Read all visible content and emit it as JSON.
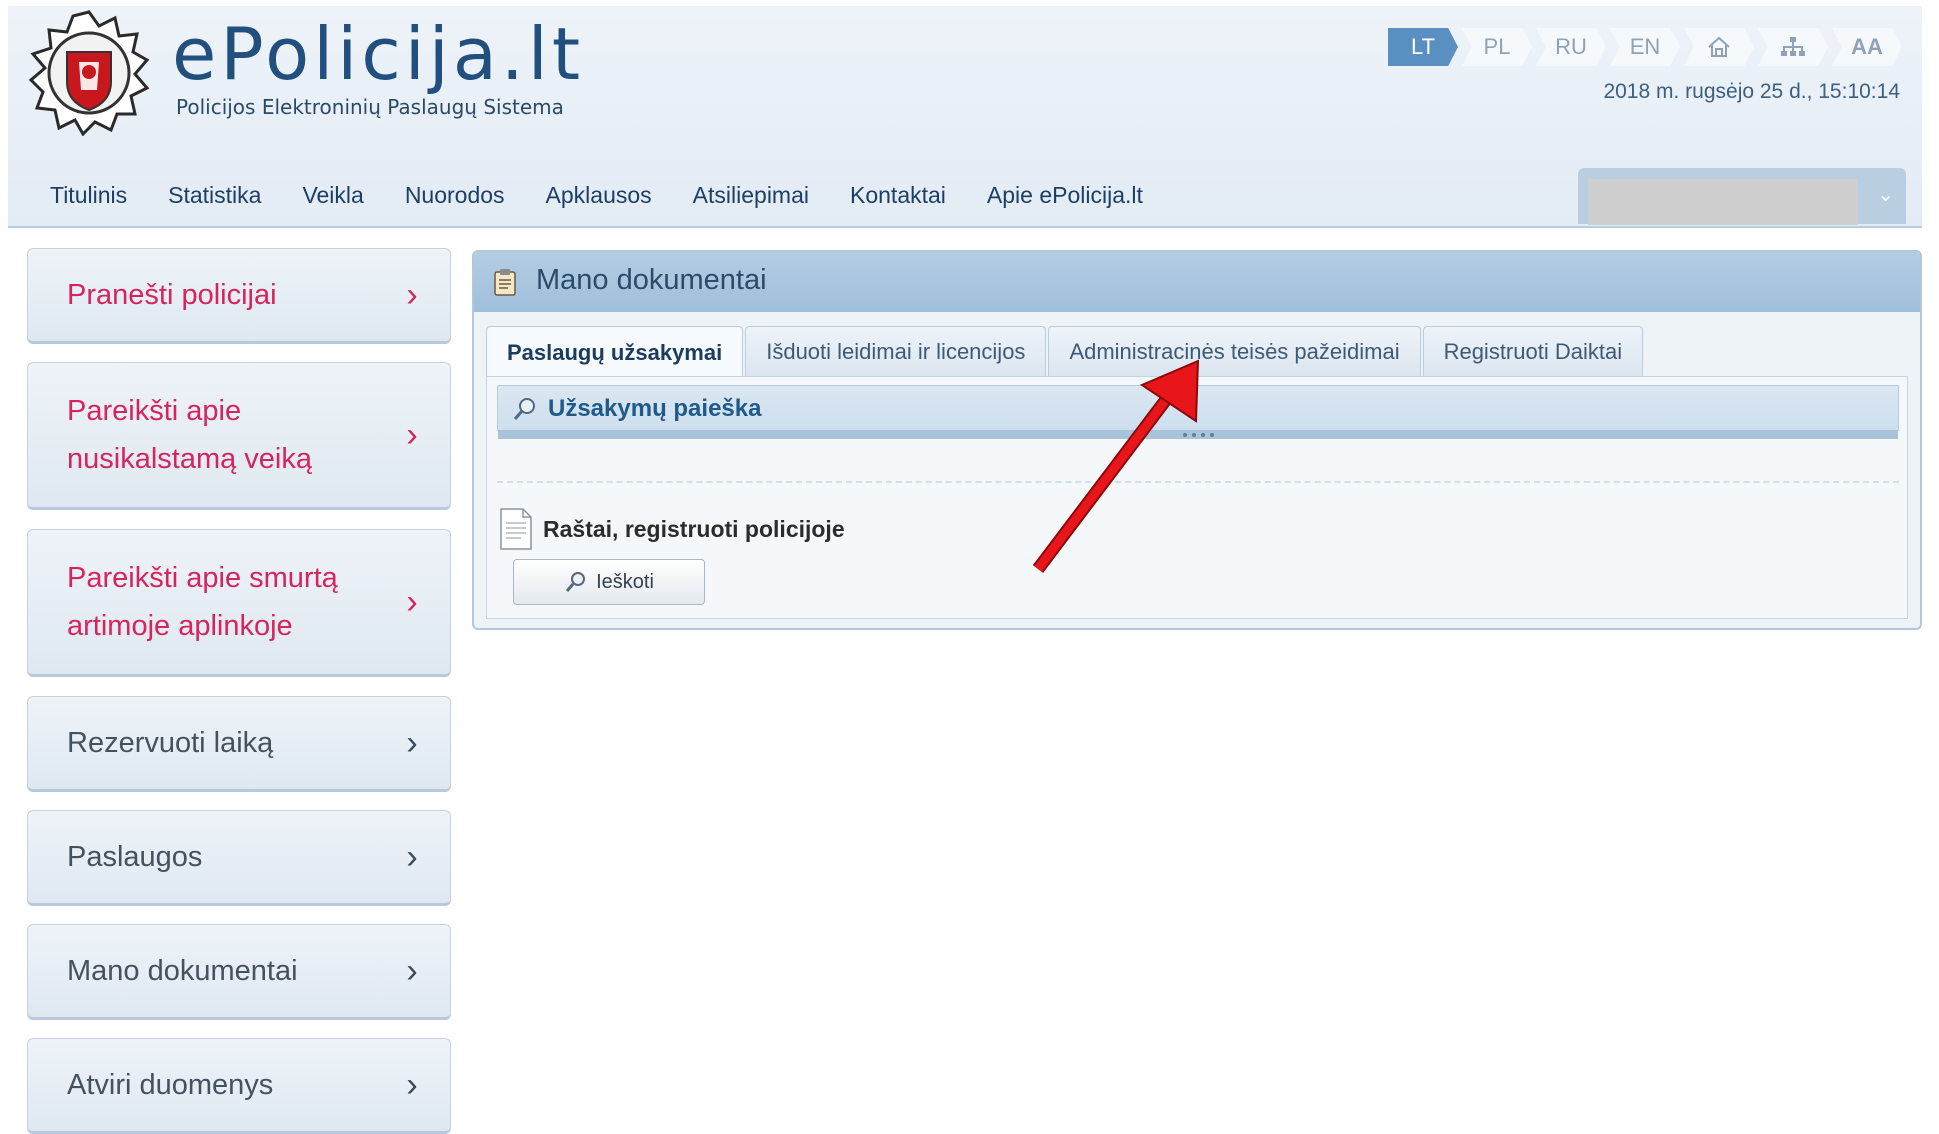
{
  "brand": {
    "title": "ePolicija.lt",
    "subtitle": "Policijos Elektroninių Paslaugų Sistema"
  },
  "languages": [
    {
      "code": "LT",
      "active": true
    },
    {
      "code": "PL",
      "active": false
    },
    {
      "code": "RU",
      "active": false
    },
    {
      "code": "EN",
      "active": false
    }
  ],
  "utility_icons": [
    "home-icon",
    "sitemap-icon",
    "font-size-icon"
  ],
  "font_size_label": "AA",
  "datetime": "2018 m. rugsėjo 25 d., 15:10:14",
  "topnav": [
    {
      "label": "Titulinis"
    },
    {
      "label": "Statistika"
    },
    {
      "label": "Veikla"
    },
    {
      "label": "Nuorodos"
    },
    {
      "label": "Apklausos"
    },
    {
      "label": "Atsiliepimai"
    },
    {
      "label": "Kontaktai"
    },
    {
      "label": "Apie ePolicija.lt"
    }
  ],
  "sidebar": {
    "items": [
      {
        "label": "Pranešti policijai",
        "style": "pink"
      },
      {
        "label": "Pareikšti apie\nnusikalstamą veiką",
        "style": "pink"
      },
      {
        "label": "Pareikšti apie smurtą\nartimoje aplinkoje",
        "style": "pink"
      },
      {
        "label": "Rezervuoti laiką",
        "style": "gray"
      },
      {
        "label": "Paslaugos",
        "style": "gray"
      },
      {
        "label": "Mano dokumentai",
        "style": "gray"
      },
      {
        "label": "Atviri duomenys",
        "style": "gray"
      }
    ]
  },
  "panel": {
    "title": "Mano dokumentai",
    "tabs": [
      {
        "label": "Paslaugų užsakymai",
        "active": true
      },
      {
        "label": "Išduoti leidimai ir licencijos",
        "active": false
      },
      {
        "label": "Administracinės teisės pažeidimai",
        "active": false
      },
      {
        "label": "Registruoti Daiktai",
        "active": false
      }
    ],
    "search_section": "Užsakymų paieška",
    "documents_title": "Raštai, registruoti policijoje",
    "search_button": "Ieškoti"
  },
  "colors": {
    "accent_pink": "#d6245d",
    "brand_blue": "#214f7e",
    "annotation_arrow": "#e8151b"
  }
}
